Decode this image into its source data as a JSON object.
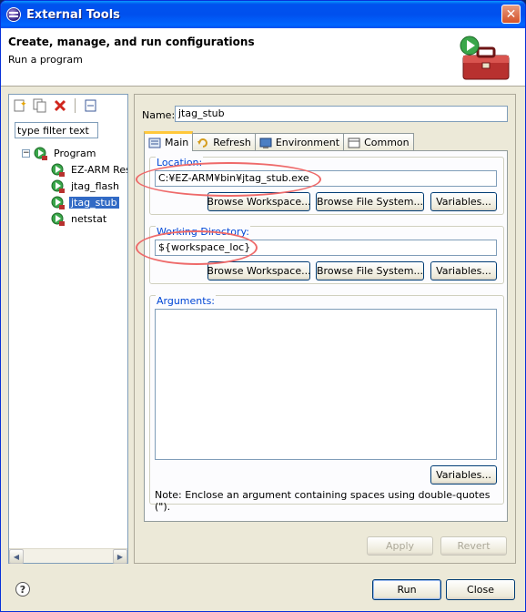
{
  "window": {
    "title": "External Tools"
  },
  "banner": {
    "title": "Create, manage, and run configurations",
    "subtitle": "Run a program"
  },
  "left": {
    "toolbar": [
      "new-config-icon",
      "duplicate-icon",
      "delete-icon",
      "collapse-all-icon"
    ],
    "filter_value": "type filter text",
    "tree": {
      "root": "Program",
      "items": [
        "EZ-ARM Reset",
        "jtag_flash",
        "jtag_stub",
        "netstat"
      ],
      "selected": "jtag_stub"
    }
  },
  "config": {
    "name_label": "Name:",
    "name_value": "jtag_stub",
    "tabs": [
      {
        "label": "Main",
        "icon": "main-tab-icon"
      },
      {
        "label": "Refresh",
        "icon": "refresh-icon"
      },
      {
        "label": "Environment",
        "icon": "environment-icon"
      },
      {
        "label": "Common",
        "icon": "common-icon"
      }
    ],
    "location": {
      "label": "Location:",
      "value": "C:¥EZ-ARM¥bin¥jtag_stub.exe",
      "browse_workspace": "Browse Workspace...",
      "browse_fs": "Browse File System...",
      "variables": "Variables..."
    },
    "working_dir": {
      "label": "Working Directory:",
      "value": "${workspace_loc}",
      "browse_workspace": "Browse Workspace...",
      "browse_fs": "Browse File System...",
      "variables": "Variables..."
    },
    "arguments": {
      "label": "Arguments:",
      "value": "",
      "variables": "Variables...",
      "note": "Note: Enclose an argument containing spaces using double-quotes (\")."
    },
    "apply": "Apply",
    "revert": "Revert"
  },
  "footer": {
    "run": "Run",
    "close": "Close"
  },
  "colors": {
    "highlight_ellipse": "#ee6a6a",
    "selection": "#316ac5",
    "group_label": "#0046d5"
  }
}
